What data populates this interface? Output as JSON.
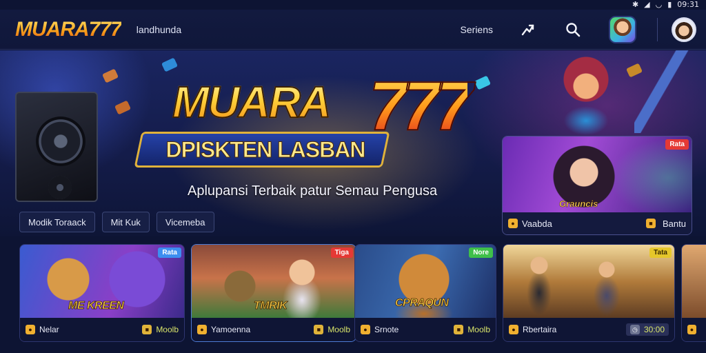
{
  "status_bar": {
    "icons": [
      "bluetooth-icon",
      "signal-icon",
      "wifi-icon",
      "battery-icon"
    ],
    "time": "09:31"
  },
  "header": {
    "logo": "MUARA777",
    "nav_link": "landhunda",
    "search_label": "Seriens",
    "icons": [
      "share-icon",
      "search-icon"
    ]
  },
  "hero": {
    "title": "MUARA",
    "title_number": "777",
    "subtitle": "DPISKTEN LASBAN",
    "tagline": "Aplupansi Terbaik patur Semau Pengusa"
  },
  "chips": [
    "Modik Toraack",
    "Mit Kuk",
    "Vicemeba"
  ],
  "featured": {
    "art_title": "Grauncis",
    "tag": "Rata",
    "left_label": "Vaabda",
    "right_label": "Bantu"
  },
  "cards": [
    {
      "art_title": "ME KREEN",
      "tag": "Rata",
      "left_label": "Nelar",
      "right_label": "Moolb"
    },
    {
      "art_title": "TMRIK",
      "tag": "Tiga",
      "left_label": "Yamoenna",
      "right_label": "Moolb"
    },
    {
      "art_title": "CPRAQUN",
      "tag": "Nore",
      "left_label": "Srnote",
      "right_label": "Moolb"
    },
    {
      "art_title": "",
      "tag": "Tata",
      "left_label": "Rbertaira",
      "right_label": "30:00"
    }
  ],
  "colors": {
    "background": "#0d1433",
    "header": "#121a3f",
    "accent_gold": "#ffd13a",
    "accent_red": "#e0211d",
    "tag_blue": "#3d8ef0",
    "tag_red": "#e53935",
    "tag_green": "#3fbf4a",
    "tag_yellow": "#e6c72a"
  }
}
